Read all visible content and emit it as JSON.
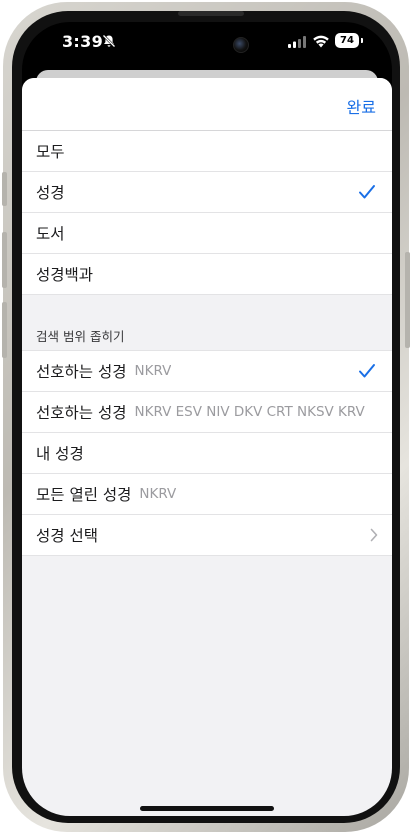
{
  "status": {
    "time": "3:39",
    "battery": "74"
  },
  "header": {
    "done_label": "완료"
  },
  "scope_options": [
    {
      "label": "모두",
      "checked": false
    },
    {
      "label": "성경",
      "checked": true
    },
    {
      "label": "도서",
      "checked": false
    },
    {
      "label": "성경백과",
      "checked": false
    }
  ],
  "narrow": {
    "section_title": "검색 범위 좁히기",
    "items": [
      {
        "label": "선호하는 성경",
        "sub": "NKRV",
        "checked": true
      },
      {
        "label": "선호하는 성경",
        "sub": "NKRV ESV NIV DKV CRT NKSV KRV",
        "checked": false
      },
      {
        "label": "내 성경",
        "sub": "",
        "checked": false
      },
      {
        "label": "모든 열린 성경",
        "sub": "NKRV",
        "checked": false
      },
      {
        "label": "성경 선택",
        "sub": "",
        "checked": false
      }
    ]
  },
  "colors": {
    "accent": "#1a6fe6",
    "secondary_text": "#9b9b9f"
  }
}
